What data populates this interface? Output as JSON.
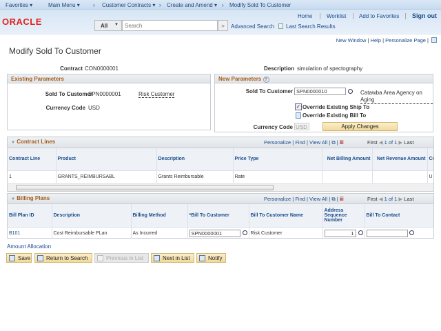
{
  "nav": {
    "breadcrumbs": [
      "Favorites",
      "Main Menu",
      "Customer Contracts",
      "Create and Amend",
      "Modify Sold To Customer"
    ]
  },
  "header": {
    "logo": "ORACLE",
    "links": [
      "Home",
      "Worklist",
      "Add to Favorites",
      "Sign out"
    ],
    "search_scope": "All",
    "search_placeholder": "Search",
    "advanced_search": "Advanced Search",
    "last_search_results": "Last Search Results"
  },
  "pagebar": {
    "new_window": "New Window",
    "help": "Help",
    "personalize_page": "Personalize Page"
  },
  "title": "Modify Sold To Customer",
  "contract": {
    "label": "Contract",
    "value": "CON0000001",
    "desc_label": "Description",
    "desc_value": "simulation of spectography"
  },
  "existing": {
    "title": "Existing Parameters",
    "sold_to_label": "Sold To Customer",
    "sold_to_value": "SPN0000001",
    "sold_to_name": "Risk Customer",
    "currency_label": "Currency Code",
    "currency_value": "USD"
  },
  "new_params": {
    "title": "New Parameters",
    "sold_to_label": "Sold To Customer",
    "sold_to_value": "SPN0000010",
    "sold_to_name": "Catawba Area Agency on Aging",
    "override_ship": "Override Existing Ship To",
    "override_ship_checked": true,
    "override_bill": "Override Existing Bill To",
    "override_bill_checked": false,
    "currency_label": "Currency Code",
    "currency_value": "USD",
    "apply": "Apply Changes"
  },
  "grid_nav": {
    "personalize": "Personalize",
    "find": "Find",
    "view_all": "View All",
    "first": "First",
    "count": "1 of 1",
    "last": "Last"
  },
  "contract_lines": {
    "title": "Contract Lines",
    "columns": [
      "Contract Line",
      "Product",
      "Description",
      "Price Type",
      "Net Billing Amount",
      "Net Revenue Amount",
      "Cu Co"
    ],
    "rows": [
      [
        "1",
        "GRANTS_REIMBURSABL",
        "Grants Reimbursable",
        "Rate",
        "",
        "",
        "U"
      ]
    ]
  },
  "billing_plans": {
    "title": "Billing Plans",
    "columns": [
      "Bill Plan ID",
      "Description",
      "Billing Method",
      "*Bill To Customer",
      "Bill To Customer Name",
      "Address Sequence Number",
      "Bill To Contact"
    ],
    "rows": [
      [
        "B101",
        "Cost Reimbursable PLan",
        "As Incurred",
        "SPN0000001",
        "Risk Customer",
        "1",
        ""
      ]
    ]
  },
  "amount_allocation": "Amount Allocation",
  "buttons": [
    "Save",
    "Return to Search",
    "Previous in List",
    "Next in List",
    "Notify"
  ]
}
